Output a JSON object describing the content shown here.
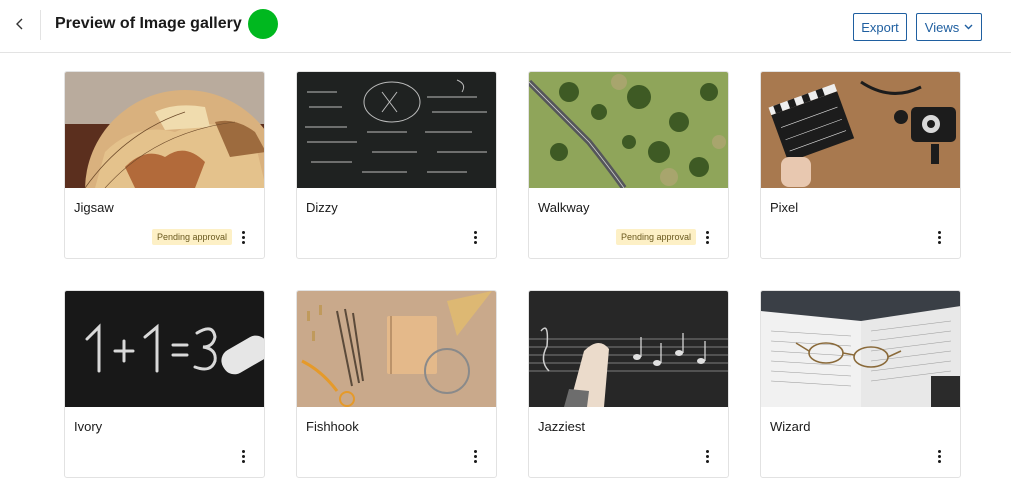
{
  "header": {
    "title": "Preview of Image gallery",
    "status_color": "#00b81f",
    "back_icon": "chevron-left-icon",
    "export_label": "Export",
    "views_label": "Views",
    "views_icon": "chevron-down-icon"
  },
  "gallery": {
    "items": [
      {
        "title": "Jigsaw",
        "badge": "Pending approval",
        "image": "globe"
      },
      {
        "title": "Dizzy",
        "badge": "",
        "image": "chalkboard-equations"
      },
      {
        "title": "Walkway",
        "badge": "Pending approval",
        "image": "aerial-road"
      },
      {
        "title": "Pixel",
        "badge": "",
        "image": "film-clapperboard"
      },
      {
        "title": "Ivory",
        "badge": "",
        "image": "chalk-math"
      },
      {
        "title": "Fishhook",
        "badge": "",
        "image": "stationery"
      },
      {
        "title": "Jazziest",
        "badge": "",
        "image": "music-chalkboard"
      },
      {
        "title": "Wizard",
        "badge": "",
        "image": "book-glasses"
      }
    ]
  }
}
